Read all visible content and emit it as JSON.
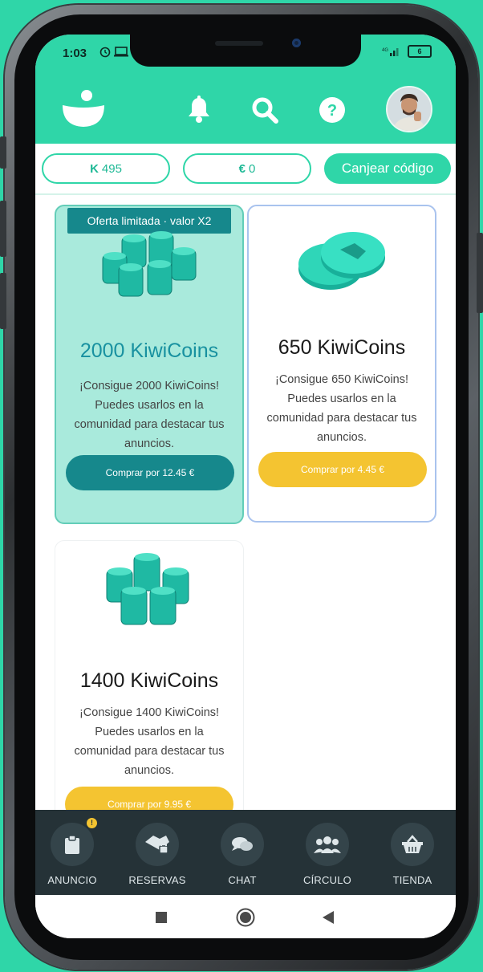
{
  "status_bar": {
    "time": "1:03",
    "battery": "6"
  },
  "balances": {
    "kiwicoins_symbol": "K",
    "kiwicoins": "495",
    "euro_symbol": "€",
    "euro": "0",
    "redeem_label": "Canjear código"
  },
  "products": [
    {
      "badge": "Oferta limitada · valor X2",
      "title": "2000 KiwiCoins",
      "description": "¡Consigue 2000 KiwiCoins! Puedes usarlos en la comunidad para destacar tus anuncios.",
      "button": "Comprar por 12.45 €"
    },
    {
      "title": "650 KiwiCoins",
      "description": "¡Consigue 650 KiwiCoins! Puedes usarlos en la comunidad para destacar tus anuncios.",
      "button": "Comprar por 4.45 €"
    },
    {
      "title": "1400 KiwiCoins",
      "description": "¡Consigue 1400 KiwiCoins! Puedes usarlos en la comunidad para destacar tus anuncios.",
      "button": "Comprar por 9.95 €"
    }
  ],
  "bottom_nav": [
    {
      "label": "ANUNCIO",
      "icon": "clipboard-icon",
      "badge": "!"
    },
    {
      "label": "RESERVAS",
      "icon": "handshake-lock-icon"
    },
    {
      "label": "CHAT",
      "icon": "chat-bubbles-icon"
    },
    {
      "label": "CÍRCULO",
      "icon": "people-group-icon"
    },
    {
      "label": "TIENDA",
      "icon": "basket-icon"
    }
  ],
  "colors": {
    "brand": "#2fd6a8",
    "teal_dark": "#16888c",
    "gold": "#f4c431",
    "nav_bg": "#253237"
  }
}
